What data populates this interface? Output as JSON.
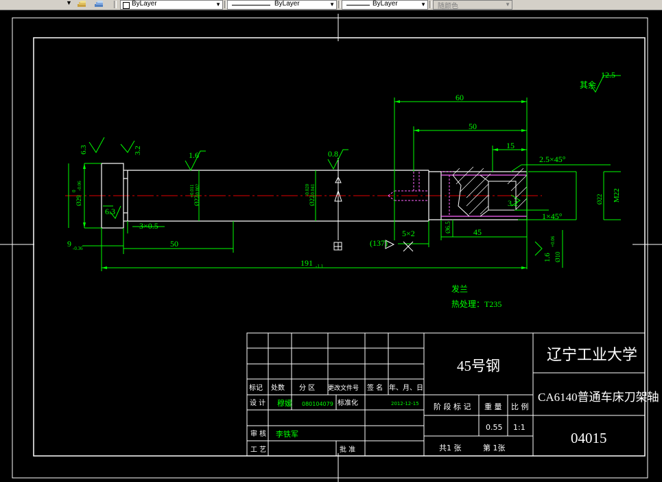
{
  "toolbar": {
    "layer_arrow": "▼",
    "color_control": "ByLayer",
    "linetype_control": "ByLayer",
    "lineweight_control": "ByLayer",
    "plotstyle_control": "随颜色"
  },
  "drawing": {
    "dims": {
      "d60": "60",
      "d50": "50",
      "d15": "15",
      "d6_3_a": "6.3",
      "d3_2_a": "3.2",
      "d1_6_a": "1.6",
      "d0_8": "0.8",
      "chamfer_2_5": "2.5×45°",
      "dia_left_main": "Ø29",
      "dia_left_tol": "-0.06",
      "dia_left_tol_zero": "0",
      "dia_mid_main": "Ø22",
      "dia_mid_tol1": "+0.011",
      "dia_mid_tol2": "-0.002",
      "dia_mid2_tol1": "-0.020",
      "dia_mid2_tol2": "-0.041",
      "dia_right": "Ø22",
      "thread": "M22",
      "d3_2_b": "3.2",
      "d6_3_b": "6.3",
      "undercut_3x0_5": "3×0.5",
      "undercut_5x2": "5×2",
      "chamfer_1x45": "1×45°",
      "d45": "45",
      "d6_5": "Ø6.5",
      "d9": "9",
      "d9_tol": "-0.36",
      "d50_bottom": "50",
      "d137": "(137)",
      "d191": "191",
      "d191_tol": "-1.1",
      "d1_6_b": "1.6",
      "d10": "Ø10",
      "d10_tol": "+0.06",
      "other_label": "其余",
      "other_value": "12.5"
    },
    "notes": {
      "line1": "发兰",
      "line2": "热处理：T235"
    }
  },
  "title_block": {
    "material": "45号钢",
    "school": "辽宁工业大学",
    "part_name": "CA6140普通车床刀架轴",
    "drawing_number": "04015",
    "header_cells": [
      "标记",
      "处数",
      "分 区",
      "更改文件号",
      "签 名",
      "年、月、日"
    ],
    "design_label": "设 计",
    "designer": "穆媛",
    "student_id": "080104079",
    "standard_label": "标准化",
    "date": "2012-12-15",
    "review_label": "审 核",
    "reviewer": "李铁军",
    "process_label": "工 艺",
    "approve_label": "批 准",
    "stage_label": "阶 段 标 记",
    "weight_label": "重 量",
    "ratio_label": "比 例",
    "weight": "0.55",
    "ratio": "1:1",
    "sheets_total": "共1  张",
    "sheet_num": "第  1张"
  }
}
